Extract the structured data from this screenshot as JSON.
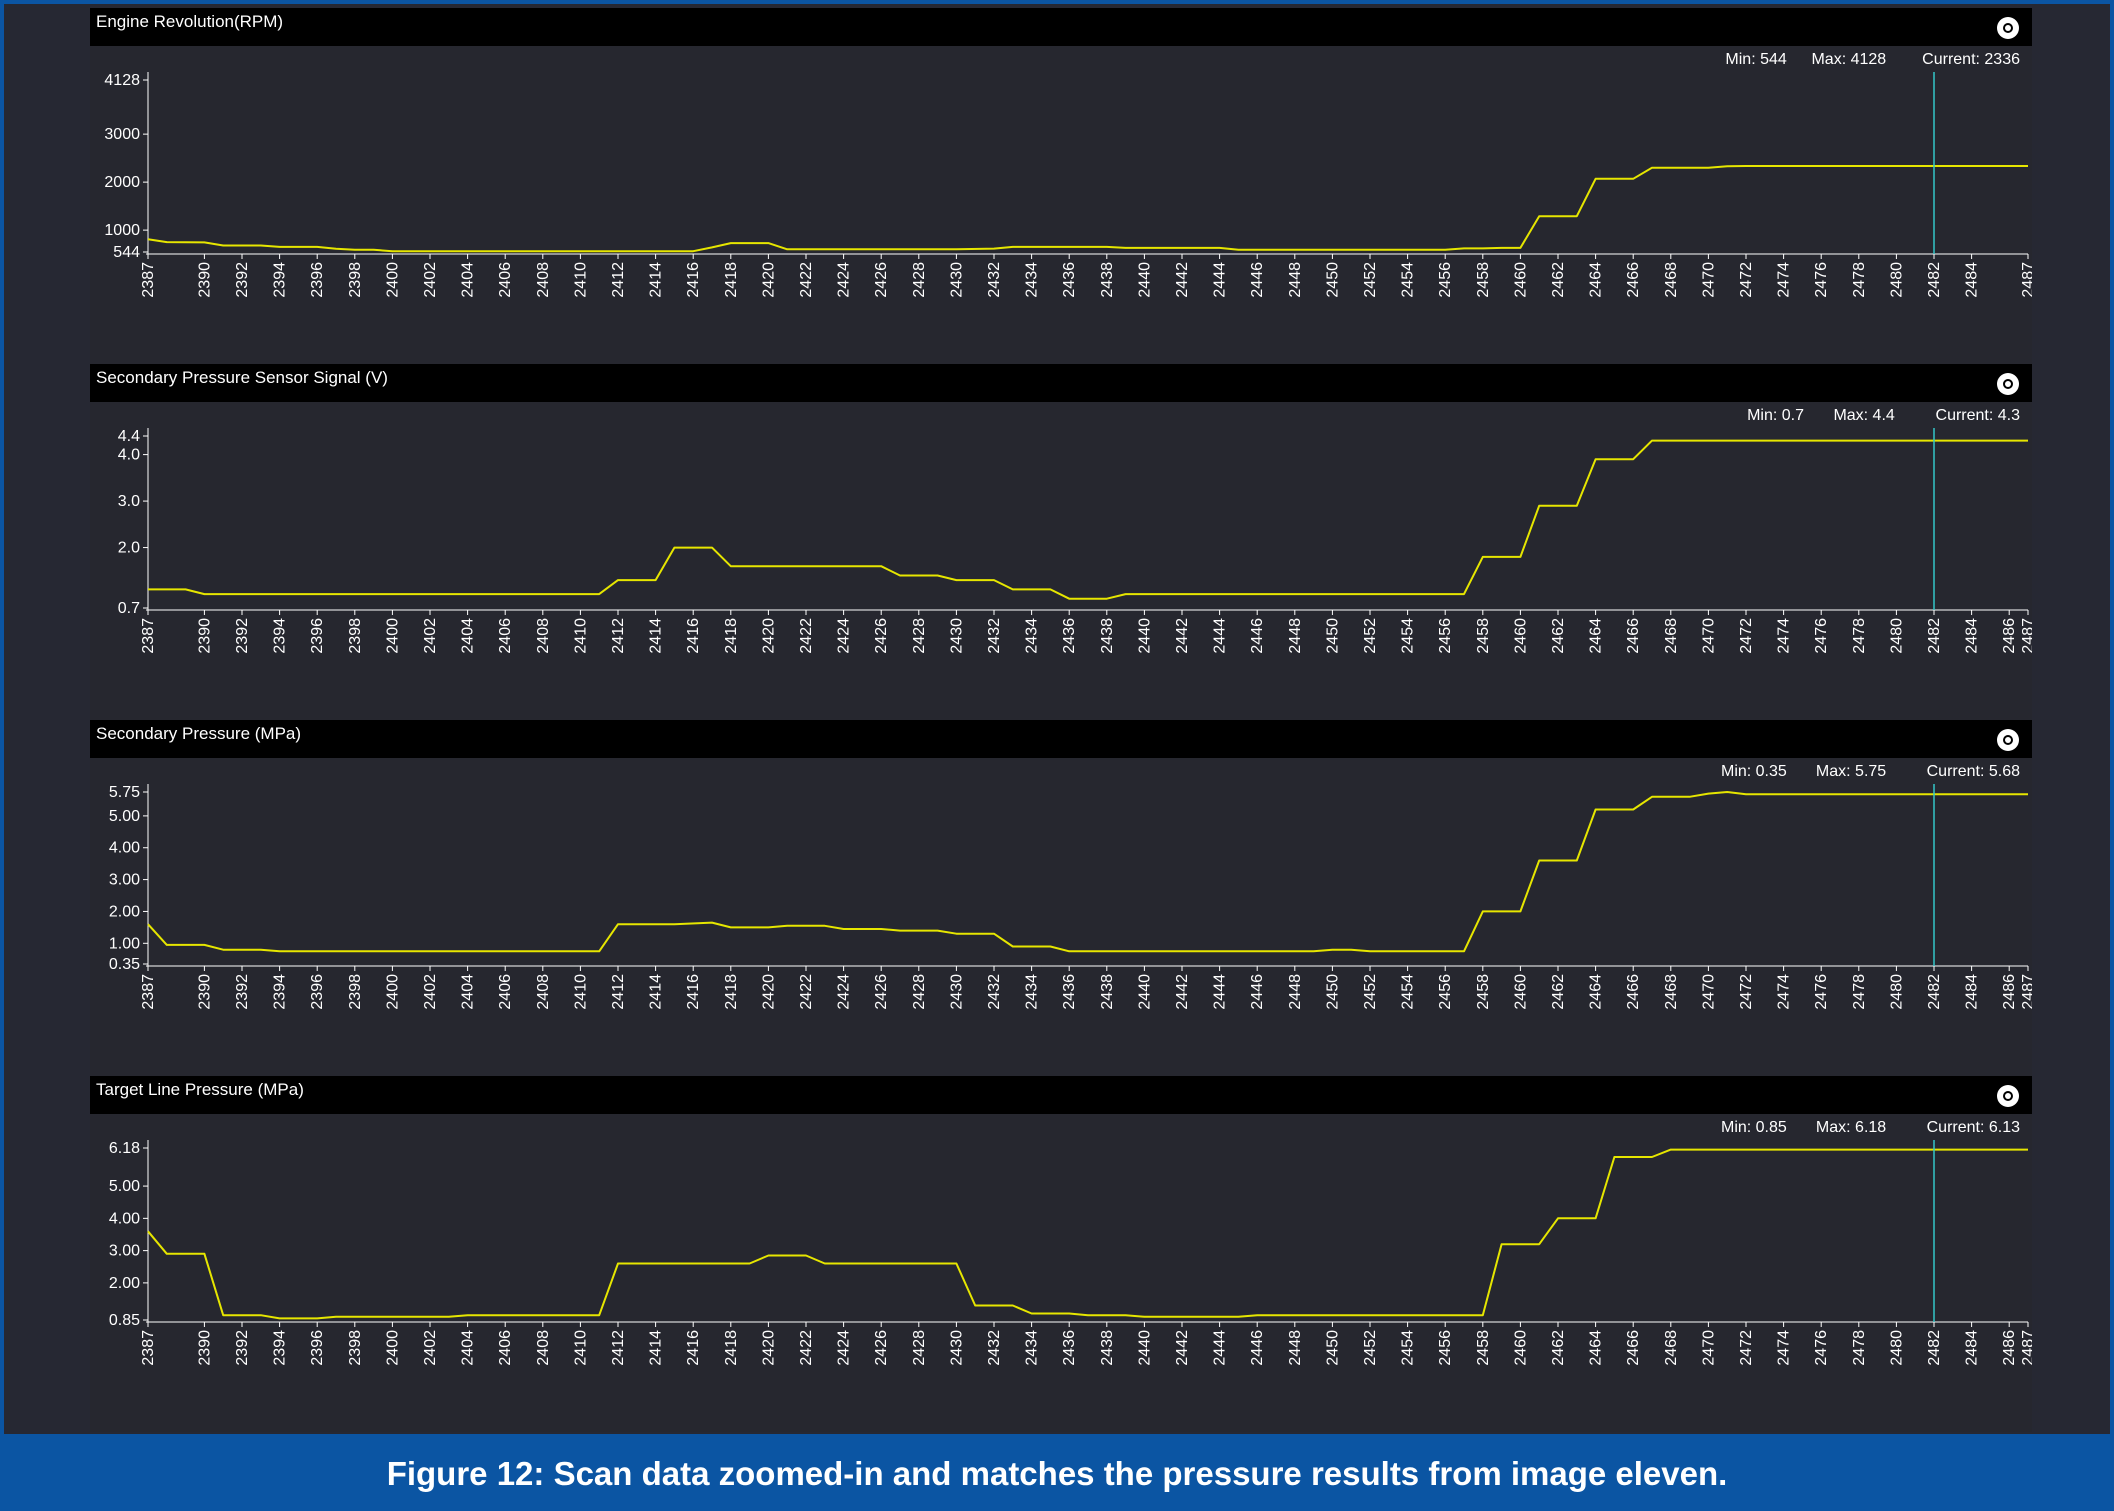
{
  "caption": "Figure 12: Scan data zoomed-in and matches the pressure results from image eleven.",
  "colors": {
    "frame": "#262833",
    "plot_bg": "#26272f",
    "title_bar": "#000000",
    "trace": "#e6e600",
    "cursor": "#34c6c8",
    "axis_text": "#ffffff"
  },
  "icons": {
    "settings": "gear-icon"
  },
  "chart_data": [
    {
      "type": "line",
      "title": "Engine Revolution(RPM)",
      "stats": {
        "min": "Min: 544",
        "max": "Max: 4128",
        "current": "Current: 2336"
      },
      "xlim": [
        2387,
        2487
      ],
      "ylim": [
        544,
        4128
      ],
      "yticks": [
        544,
        1000,
        2000,
        3000,
        4128
      ],
      "ytick_labels": [
        "544",
        "1000",
        "2000",
        "3000",
        "4128"
      ],
      "xticks": [
        2387,
        2390,
        2392,
        2394,
        2396,
        2398,
        2400,
        2402,
        2404,
        2406,
        2408,
        2410,
        2412,
        2414,
        2416,
        2418,
        2420,
        2422,
        2424,
        2426,
        2428,
        2430,
        2432,
        2434,
        2436,
        2438,
        2440,
        2442,
        2444,
        2446,
        2448,
        2450,
        2452,
        2454,
        2456,
        2458,
        2460,
        2462,
        2464,
        2466,
        2468,
        2470,
        2472,
        2474,
        2476,
        2478,
        2480,
        2482,
        2484,
        2487
      ],
      "cursor_x": 2482,
      "series": [
        {
          "x": [
            2387,
            2388,
            2390,
            2391,
            2393,
            2394,
            2396,
            2397,
            2398,
            2399,
            2400,
            2416,
            2417,
            2418,
            2420,
            2421,
            2430,
            2432,
            2433,
            2438,
            2439,
            2444,
            2445,
            2456,
            2457,
            2458,
            2459,
            2460,
            2461,
            2462,
            2463,
            2464,
            2465,
            2466,
            2467,
            2468,
            2469,
            2470,
            2471,
            2472,
            2487
          ],
          "y": [
            810,
            750,
            745,
            680,
            680,
            650,
            650,
            610,
            590,
            590,
            560,
            560,
            640,
            730,
            730,
            600,
            600,
            615,
            650,
            650,
            630,
            630,
            590,
            590,
            620,
            620,
            630,
            630,
            1290,
            1290,
            1290,
            2070,
            2070,
            2070,
            2300,
            2300,
            2300,
            2300,
            2330,
            2336,
            2336
          ]
        }
      ]
    },
    {
      "type": "line",
      "title": "Secondary Pressure Sensor Signal (V)",
      "stats": {
        "min": "Min: 0.7",
        "max": "Max: 4.4",
        "current": "Current: 4.3"
      },
      "xlim": [
        2387,
        2487
      ],
      "ylim": [
        0.7,
        4.4
      ],
      "yticks": [
        0.7,
        2.0,
        3.0,
        4.0,
        4.4
      ],
      "ytick_labels": [
        "0.7",
        "2.0",
        "3.0",
        "4.0",
        "4.4"
      ],
      "xticks": [
        2387,
        2390,
        2392,
        2394,
        2396,
        2398,
        2400,
        2402,
        2404,
        2406,
        2408,
        2410,
        2412,
        2414,
        2416,
        2418,
        2420,
        2422,
        2424,
        2426,
        2428,
        2430,
        2432,
        2434,
        2436,
        2438,
        2440,
        2442,
        2444,
        2446,
        2448,
        2450,
        2452,
        2454,
        2456,
        2458,
        2460,
        2462,
        2464,
        2466,
        2468,
        2470,
        2472,
        2474,
        2476,
        2478,
        2480,
        2482,
        2484,
        2486,
        2487
      ],
      "cursor_x": 2482,
      "series": [
        {
          "x": [
            2387,
            2389,
            2390,
            2411,
            2412,
            2414,
            2415,
            2417,
            2418,
            2426,
            2427,
            2429,
            2430,
            2432,
            2433,
            2435,
            2436,
            2438,
            2439,
            2457,
            2458,
            2460,
            2461,
            2463,
            2464,
            2466,
            2467,
            2487
          ],
          "y": [
            1.1,
            1.1,
            1.0,
            1.0,
            1.3,
            1.3,
            2.0,
            2.0,
            1.6,
            1.6,
            1.4,
            1.4,
            1.3,
            1.3,
            1.1,
            1.1,
            0.9,
            0.9,
            1.0,
            1.0,
            1.8,
            1.8,
            2.9,
            2.9,
            3.9,
            3.9,
            4.3,
            4.3
          ]
        }
      ]
    },
    {
      "type": "line",
      "title": "Secondary Pressure (MPa)",
      "stats": {
        "min": "Min: 0.35",
        "max": "Max: 5.75",
        "current": "Current: 5.68"
      },
      "xlim": [
        2387,
        2487
      ],
      "ylim": [
        0.35,
        5.75
      ],
      "yticks": [
        0.35,
        1.0,
        2.0,
        3.0,
        4.0,
        5.0,
        5.75
      ],
      "ytick_labels": [
        "0.35",
        "1.00",
        "2.00",
        "3.00",
        "4.00",
        "5.00",
        "5.75"
      ],
      "xticks": [
        2387,
        2390,
        2392,
        2394,
        2396,
        2398,
        2400,
        2402,
        2404,
        2406,
        2408,
        2410,
        2412,
        2414,
        2416,
        2418,
        2420,
        2422,
        2424,
        2426,
        2428,
        2430,
        2432,
        2434,
        2436,
        2438,
        2440,
        2442,
        2444,
        2446,
        2448,
        2450,
        2452,
        2454,
        2456,
        2458,
        2460,
        2462,
        2464,
        2466,
        2468,
        2470,
        2472,
        2474,
        2476,
        2478,
        2480,
        2482,
        2484,
        2486,
        2487
      ],
      "cursor_x": 2482,
      "series": [
        {
          "x": [
            2387,
            2388,
            2390,
            2391,
            2393,
            2394,
            2411,
            2412,
            2415,
            2417,
            2418,
            2420,
            2421,
            2423,
            2424,
            2426,
            2427,
            2429,
            2430,
            2432,
            2433,
            2435,
            2436,
            2449,
            2450,
            2451,
            2452,
            2457,
            2458,
            2460,
            2461,
            2463,
            2464,
            2466,
            2467,
            2469,
            2470,
            2471,
            2472,
            2487
          ],
          "y": [
            1.6,
            0.95,
            0.95,
            0.8,
            0.8,
            0.75,
            0.75,
            1.6,
            1.6,
            1.65,
            1.5,
            1.5,
            1.55,
            1.55,
            1.45,
            1.45,
            1.4,
            1.4,
            1.3,
            1.3,
            0.9,
            0.9,
            0.75,
            0.75,
            0.8,
            0.8,
            0.75,
            0.75,
            2.0,
            2.0,
            3.6,
            3.6,
            5.2,
            5.2,
            5.6,
            5.6,
            5.7,
            5.75,
            5.68,
            5.68
          ]
        }
      ]
    },
    {
      "type": "line",
      "title": "Target Line Pressure (MPa)",
      "stats": {
        "min": "Min: 0.85",
        "max": "Max: 6.18",
        "current": "Current: 6.13"
      },
      "xlim": [
        2387,
        2487
      ],
      "ylim": [
        0.85,
        6.18
      ],
      "yticks": [
        0.85,
        2.0,
        3.0,
        4.0,
        5.0,
        6.18
      ],
      "ytick_labels": [
        "0.85",
        "2.00",
        "3.00",
        "4.00",
        "5.00",
        "6.18"
      ],
      "xticks": [
        2387,
        2390,
        2392,
        2394,
        2396,
        2398,
        2400,
        2402,
        2404,
        2406,
        2408,
        2410,
        2412,
        2414,
        2416,
        2418,
        2420,
        2422,
        2424,
        2426,
        2428,
        2430,
        2432,
        2434,
        2436,
        2438,
        2440,
        2442,
        2444,
        2446,
        2448,
        2450,
        2452,
        2454,
        2456,
        2458,
        2460,
        2462,
        2464,
        2466,
        2468,
        2470,
        2472,
        2474,
        2476,
        2478,
        2480,
        2482,
        2484,
        2486,
        2487
      ],
      "cursor_x": 2482,
      "series": [
        {
          "x": [
            2387,
            2388,
            2390,
            2391,
            2393,
            2394,
            2396,
            2397,
            2403,
            2404,
            2411,
            2412,
            2419,
            2420,
            2422,
            2423,
            2430,
            2431,
            2433,
            2434,
            2436,
            2437,
            2439,
            2440,
            2445,
            2446,
            2458,
            2459,
            2461,
            2462,
            2464,
            2465,
            2467,
            2468,
            2487
          ],
          "y": [
            3.6,
            2.9,
            2.9,
            1.0,
            1.0,
            0.9,
            0.9,
            0.95,
            0.95,
            1.0,
            1.0,
            2.6,
            2.6,
            2.85,
            2.85,
            2.6,
            2.6,
            1.3,
            1.3,
            1.05,
            1.05,
            1.0,
            1.0,
            0.95,
            0.95,
            1.0,
            1.0,
            3.2,
            3.2,
            4.0,
            4.0,
            5.9,
            5.9,
            6.13,
            6.13
          ]
        }
      ]
    }
  ]
}
